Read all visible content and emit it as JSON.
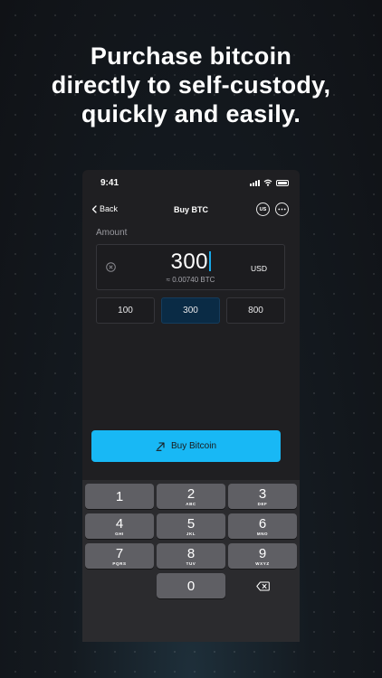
{
  "headline": {
    "line1": "Purchase bitcoin",
    "line2": "directly to self-custody,",
    "line3": "quickly and easily."
  },
  "status_bar": {
    "time": "9:41",
    "icons": [
      "cellular-signal-icon",
      "wifi-icon",
      "battery-icon"
    ]
  },
  "navbar": {
    "back_label": "Back",
    "title": "Buy BTC",
    "region_badge": "US",
    "more_icon": "ellipsis-icon"
  },
  "amount": {
    "label": "Amount",
    "value": "300",
    "btc_equivalent": "≈ 0.00740 BTC",
    "currency": "USD"
  },
  "presets": [
    {
      "label": "100",
      "selected": false
    },
    {
      "label": "300",
      "selected": true
    },
    {
      "label": "800",
      "selected": false
    }
  ],
  "buy_button": {
    "label": "Buy Bitcoin",
    "icon": "arrow-up-right-icon"
  },
  "keypad": {
    "keys": [
      {
        "digit": "1",
        "letters": ""
      },
      {
        "digit": "2",
        "letters": "ABC"
      },
      {
        "digit": "3",
        "letters": "DEF"
      },
      {
        "digit": "4",
        "letters": "GHI"
      },
      {
        "digit": "5",
        "letters": "JKL"
      },
      {
        "digit": "6",
        "letters": "MNO"
      },
      {
        "digit": "7",
        "letters": "PQRS"
      },
      {
        "digit": "8",
        "letters": "TUV"
      },
      {
        "digit": "9",
        "letters": "WXYZ"
      },
      {
        "digit": "0",
        "letters": ""
      }
    ]
  },
  "colors": {
    "accent": "#18b8f5",
    "selected_preset_bg": "#0a2b45",
    "caret": "#18a8e8",
    "key_bg": "#5f5f64"
  }
}
